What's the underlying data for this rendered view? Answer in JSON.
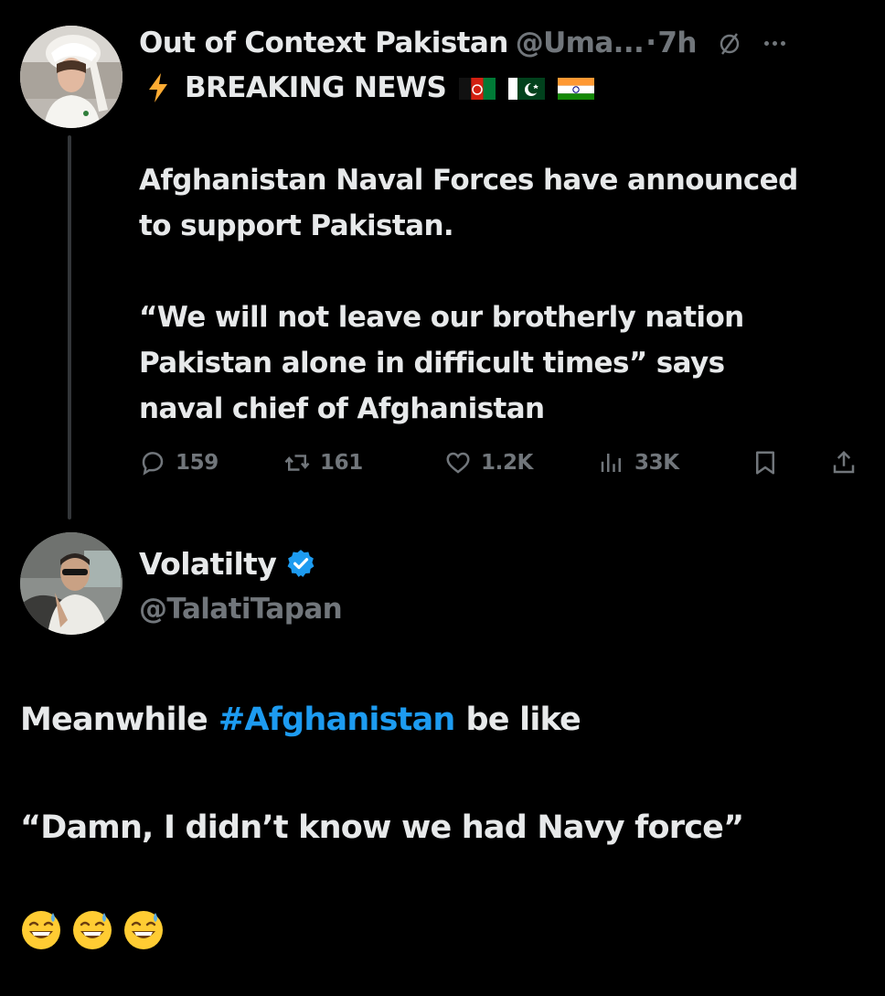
{
  "tweet1": {
    "author_name": "Out of Context Pakistan",
    "handle": "@Uma...",
    "separator": "·",
    "time": "7h",
    "breaking_label": "BREAKING NEWS",
    "breaking_icon": "lightning-bolt-icon",
    "flags": [
      "afghanistan-flag-icon",
      "pakistan-flag-icon",
      "india-flag-icon"
    ],
    "body_paragraphs": [
      [
        "Afghanistan Naval Forces have announced",
        "to support Pakistan."
      ],
      [
        "“We will not leave our brotherly nation",
        "Pakistan alone in difficult times” says",
        "naval chief of Afghanistan"
      ]
    ],
    "stats": {
      "replies": "159",
      "reposts": "161",
      "likes": "1.2K",
      "views": "33K"
    }
  },
  "tweet2": {
    "author_name": "Volatilty",
    "verified": true,
    "handle": "@TalatiTapan",
    "line1_before": "Meanwhile",
    "hashtag": "#Afghanistan",
    "line1_after": "be like",
    "line2": "“Damn, I didn’t know we had Navy force”",
    "emojis": [
      "😅",
      "😅",
      "😅"
    ]
  },
  "colors": {
    "background": "#000000",
    "text_primary": "#e7e9ea",
    "text_secondary": "#71767b",
    "link_blue": "#1d9bf0",
    "thread_line": "#333639"
  }
}
